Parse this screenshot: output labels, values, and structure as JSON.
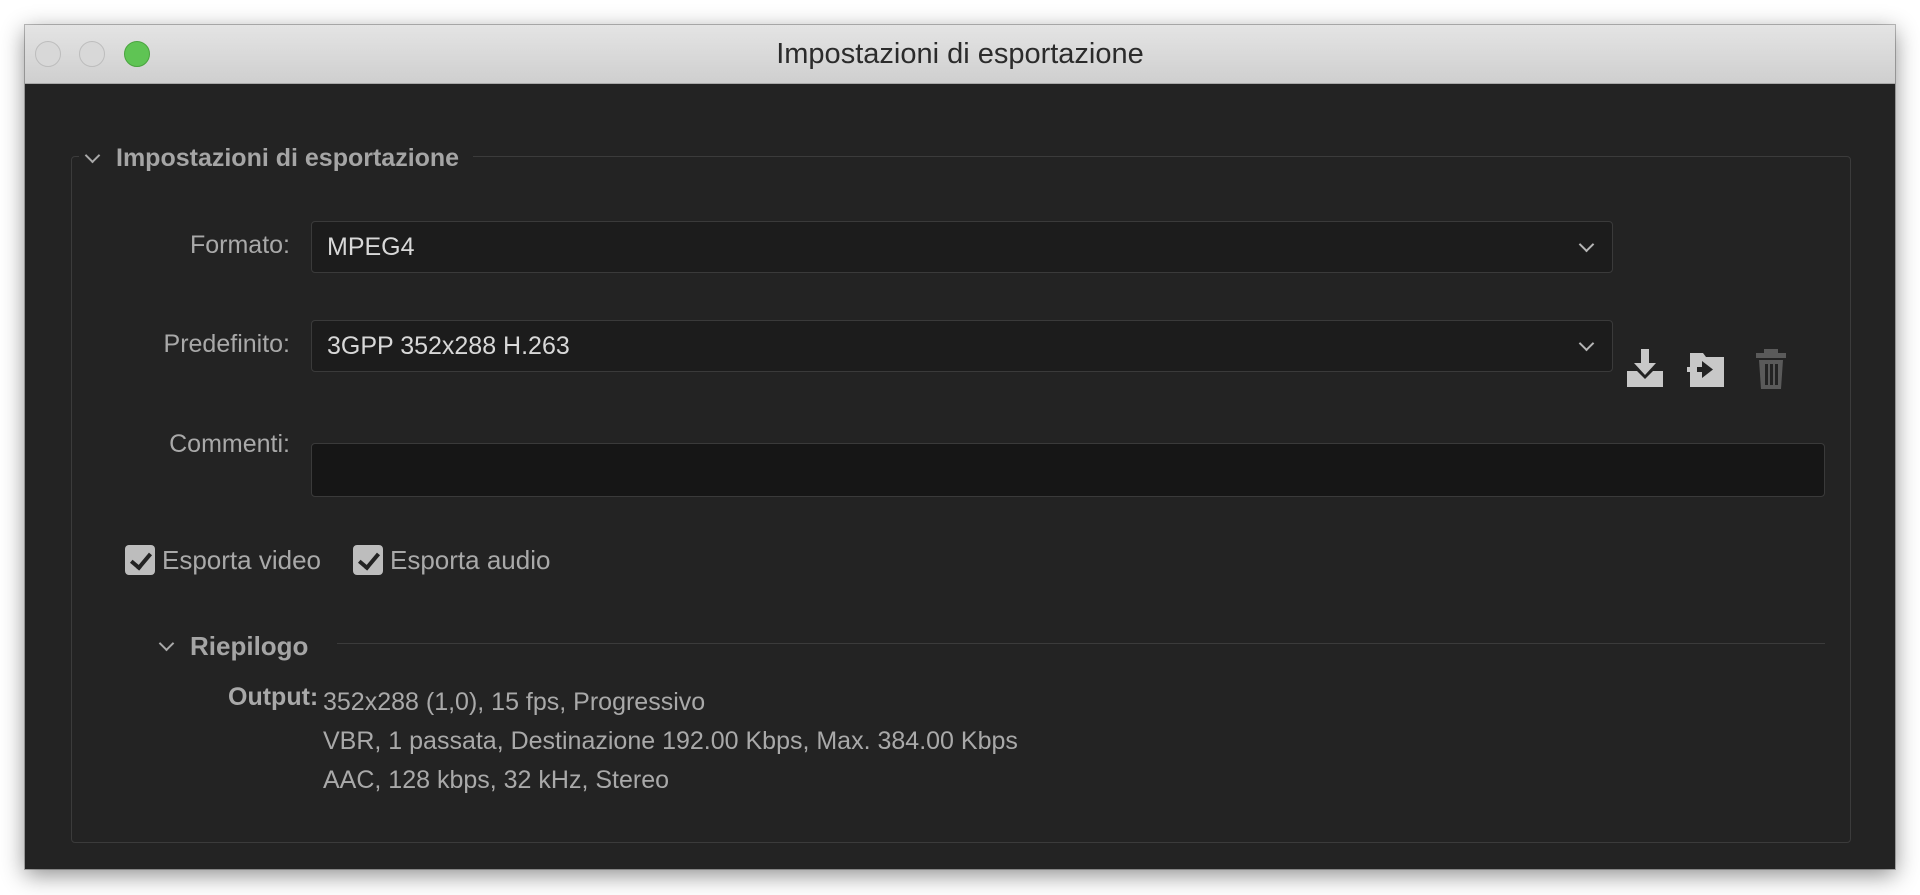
{
  "window": {
    "title": "Impostazioni di esportazione"
  },
  "section": {
    "title": "Impostazioni di esportazione"
  },
  "format": {
    "label": "Formato:",
    "value": "MPEG4"
  },
  "preset": {
    "label": "Predefinito:",
    "value": "3GPP 352x288 H.263",
    "icons": [
      "save-preset-icon",
      "import-preset-icon",
      "delete-preset-icon"
    ]
  },
  "comments": {
    "label": "Commenti:",
    "value": ""
  },
  "checkboxes": {
    "export_video": {
      "label": "Esporta video",
      "checked": true
    },
    "export_audio": {
      "label": "Esporta audio",
      "checked": true
    }
  },
  "summary": {
    "title": "Riepilogo",
    "output_label": "Output:",
    "lines": [
      "352x288 (1,0), 15 fps, Progressivo",
      "VBR, 1 passata, Destinazione 192.00 Kbps, Max. 384.00 Kbps",
      "AAC, 128 kbps, 32 kHz, Stereo"
    ]
  },
  "colors": {
    "background": "#232323",
    "titlebar": "#d6d6d6",
    "zoom_button": "#5fc454",
    "text": "#a9a9a9",
    "field": "#1c1c1c"
  }
}
